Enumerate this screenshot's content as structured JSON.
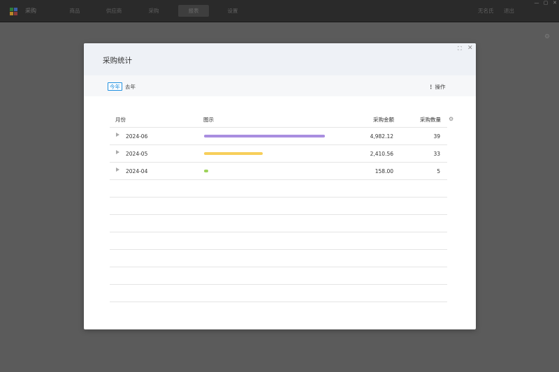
{
  "app": {
    "name": "采购",
    "nav": [
      "商品",
      "供应商",
      "采购",
      "报表",
      "设置"
    ],
    "active_nav": "报表",
    "user": "无名氏",
    "logout": "退出",
    "window_controls": [
      "—",
      "▢",
      "✕"
    ]
  },
  "modal": {
    "title": "采购统计",
    "expand_icon": "fullscreen-icon",
    "close_icon": "close-icon",
    "filters": {
      "this_year": "今年",
      "last_year": "去年",
      "selected": "今年"
    },
    "operations_label": "操作",
    "table": {
      "columns": [
        "月份",
        "图示",
        "采购金额",
        "采购数量"
      ],
      "rows": [
        {
          "month": "2024-06",
          "amount": "4,982.12",
          "quantity": "39",
          "bar_fraction": 1.0,
          "bar_color": "#a98ee0"
        },
        {
          "month": "2024-05",
          "amount": "2,410.56",
          "quantity": "33",
          "bar_fraction": 0.484,
          "bar_color": "#f7cf5b"
        },
        {
          "month": "2024-04",
          "amount": "158.00",
          "quantity": "5",
          "bar_fraction": 0.032,
          "bar_color": "#9ed25a"
        }
      ]
    }
  }
}
